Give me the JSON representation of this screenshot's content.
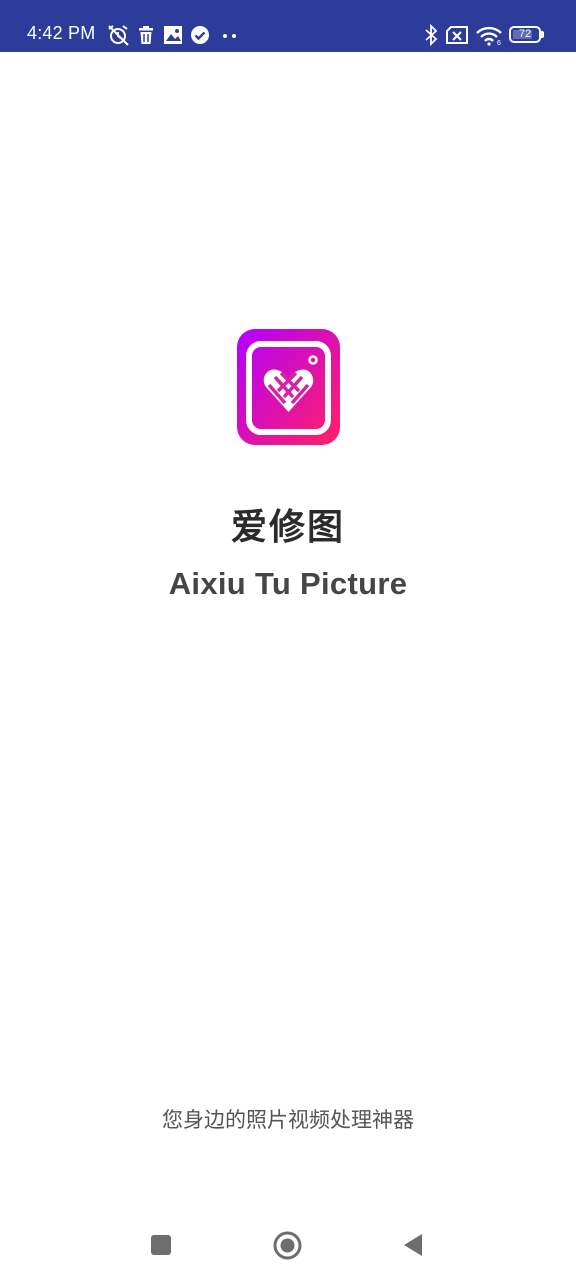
{
  "status_bar": {
    "time": "4:42 PM",
    "battery_level": "72",
    "background_color": "#2d3c9a",
    "left_icons": [
      "muted-alarm-icon",
      "trash-icon",
      "image-icon",
      "check-circle-icon",
      "more-dots-icon"
    ],
    "right_icons": [
      "bluetooth-icon",
      "no-sim-icon",
      "wifi-icon",
      "battery-icon"
    ]
  },
  "splash": {
    "app_name_cn": "爱修图",
    "app_name_en": "Aixiu Tu Picture",
    "tagline": "您身边的照片视频处理神器",
    "logo_gradient": [
      "#b200ff",
      "#ff1f6b"
    ]
  },
  "nav_bar": {
    "buttons": [
      "recents-button",
      "home-button",
      "back-button"
    ]
  }
}
